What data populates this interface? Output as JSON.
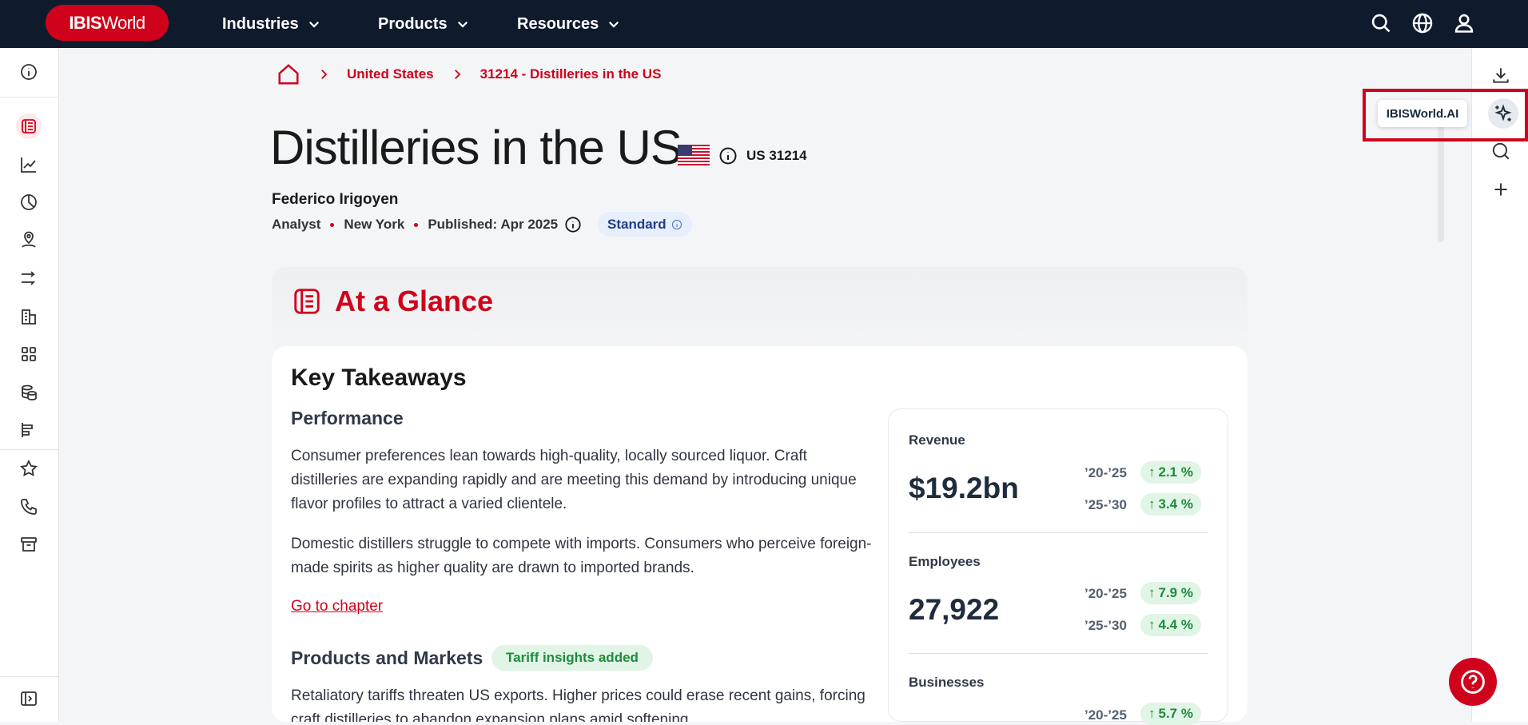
{
  "logo": {
    "bold": "IBIS",
    "light": "World"
  },
  "nav": {
    "items": [
      {
        "label": "Industries"
      },
      {
        "label": "Products"
      },
      {
        "label": "Resources"
      }
    ]
  },
  "breadcrumb": {
    "country": "United States",
    "industry": "31214 - Distilleries in the US"
  },
  "page": {
    "title": "Distilleries in the US",
    "code": "US 31214",
    "author": "Federico Irigoyen",
    "role": "Analyst",
    "location": "New York",
    "published": "Published: Apr 2025",
    "tier": "Standard"
  },
  "glance": {
    "title": "At a Glance"
  },
  "key_takeaways": {
    "title": "Key Takeaways",
    "performance": {
      "heading": "Performance",
      "p1": "Consumer preferences lean towards high-quality, locally sourced liquor. Craft distilleries are expanding rapidly and are meeting this demand by introducing unique flavor profiles to attract a varied clientele.",
      "p2": "Domestic distillers struggle to compete with imports. Consumers who perceive foreign-made spirits as higher quality are drawn to imported brands.",
      "link": "Go to chapter"
    },
    "products": {
      "heading": "Products and Markets",
      "badge": "Tariff insights added",
      "p1": "Retaliatory tariffs threaten US exports. Higher prices could erase recent gains, forcing craft distilleries to abandon expansion plans amid softening"
    }
  },
  "stats": {
    "revenue": {
      "label": "Revenue",
      "value": "$19.2bn",
      "p1": "’20-’25",
      "g1": "2.1 %",
      "p2": "’25-’30",
      "g2": "3.4 %"
    },
    "employees": {
      "label": "Employees",
      "value": "27,922",
      "p1": "’20-’25",
      "g1": "7.9 %",
      "p2": "’25-’30",
      "g2": "4.4 %"
    },
    "businesses": {
      "label": "Businesses",
      "value": "",
      "p1": "’20-’25",
      "g1": "5.7 %"
    }
  },
  "ai": {
    "tooltip": "IBISWorld.AI"
  },
  "colors": {
    "brand": "#d0021b",
    "nav": "#0f1b2d",
    "positive": "#1f8a3c"
  }
}
